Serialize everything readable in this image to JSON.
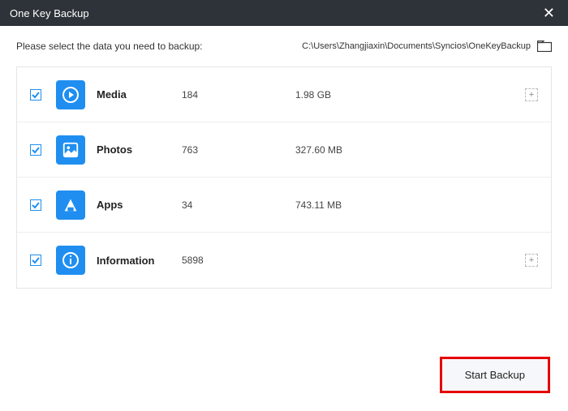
{
  "titlebar": {
    "title": "One Key Backup"
  },
  "prompt": "Please select the data you need to backup:",
  "backup_path": "C:\\Users\\Zhangjiaxin\\Documents\\Syncios\\OneKeyBackup",
  "items": [
    {
      "icon": "media-icon",
      "label": "Media",
      "count": "184",
      "size": "1.98 GB",
      "checked": true,
      "expandable": true
    },
    {
      "icon": "photos-icon",
      "label": "Photos",
      "count": "763",
      "size": "327.60 MB",
      "checked": true,
      "expandable": false
    },
    {
      "icon": "apps-icon",
      "label": "Apps",
      "count": "34",
      "size": "743.11 MB",
      "checked": true,
      "expandable": false
    },
    {
      "icon": "information-icon",
      "label": "Information",
      "count": "5898",
      "size": "",
      "checked": true,
      "expandable": true
    }
  ],
  "buttons": {
    "start": "Start Backup"
  }
}
